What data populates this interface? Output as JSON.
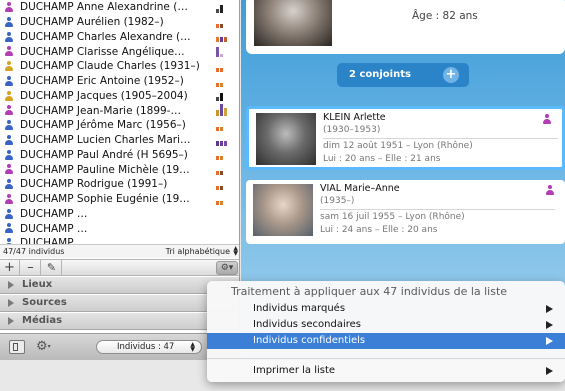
{
  "persons": [
    {
      "name": "DUCHAMP Anne Alexandrine (…",
      "sex": "f",
      "bars": [
        {
          "h": 4,
          "c": "#4a4a4a"
        },
        {
          "h": 8,
          "c": "#222222"
        }
      ]
    },
    {
      "name": "DUCHAMP Aurélien (1982–)",
      "sex": "m",
      "bars": [
        {
          "h": 4,
          "c": "#e86d2c"
        },
        {
          "h": 4,
          "c": "#8a4a2c"
        }
      ]
    },
    {
      "name": "DUCHAMP Charles Alexandre (…",
      "sex": "m",
      "bars": [
        {
          "h": 5,
          "c": "#e07a2a"
        },
        {
          "h": 5,
          "c": "#6b3b9a"
        },
        {
          "h": 5,
          "c": "#c25f2a"
        }
      ]
    },
    {
      "name": "DUCHAMP Clarisse Angélique…",
      "sex": "f",
      "bars": [
        {
          "h": 10,
          "c": "#7a55a6"
        },
        {
          "h": 3,
          "c": "#c9a8dc"
        }
      ]
    },
    {
      "name": "DUCHAMP Claude Charles (1931–)",
      "sex": "u",
      "bars": [
        {
          "h": 4,
          "c": "#e86d2c"
        },
        {
          "h": 4,
          "c": "#e86d2c"
        }
      ]
    },
    {
      "name": "DUCHAMP Eric Antoine (1952–)",
      "sex": "m",
      "bars": [
        {
          "h": 4,
          "c": "#e86d2c"
        },
        {
          "h": 4,
          "c": "#d9832f"
        }
      ]
    },
    {
      "name": "DUCHAMP Jacques (1905–2004)",
      "sex": "u",
      "bars": [
        {
          "h": 4,
          "c": "#444444"
        },
        {
          "h": 8,
          "c": "#111111"
        }
      ]
    },
    {
      "name": "DUCHAMP Jean-Marie (1899-…",
      "sex": "f",
      "bars": [
        {
          "h": 6,
          "c": "#c9962a"
        },
        {
          "h": 12,
          "c": "#6a4aa0"
        },
        {
          "h": 8,
          "c": "#d4a23a"
        }
      ]
    },
    {
      "name": "DUCHAMP Jérôme Marc (1956–)",
      "sex": "m",
      "bars": [
        {
          "h": 4,
          "c": "#e86d2c"
        },
        {
          "h": 4,
          "c": "#d9832f"
        }
      ]
    },
    {
      "name": "DUCHAMP Lucien Charles Mari…",
      "sex": "m",
      "bars": [
        {
          "h": 5,
          "c": "#5a3a8a"
        },
        {
          "h": 5,
          "c": "#6b3b9a"
        },
        {
          "h": 5,
          "c": "#7a4aa8"
        }
      ]
    },
    {
      "name": "DUCHAMP Paul André (H 5695–)",
      "sex": "m",
      "bars": [
        {
          "h": 4,
          "c": "#e86d2c"
        },
        {
          "h": 4,
          "c": "#d9832f"
        }
      ]
    },
    {
      "name": "DUCHAMP Pauline Michèle (19…",
      "sex": "f",
      "bars": [
        {
          "h": 4,
          "c": "#e86d2c"
        },
        {
          "h": 4,
          "c": "#8a4a2c"
        }
      ]
    },
    {
      "name": "DUCHAMP Rodrigue (1991–)",
      "sex": "m",
      "bars": [
        {
          "h": 4,
          "c": "#e86d2c"
        },
        {
          "h": 4,
          "c": "#8a4a2c"
        }
      ]
    },
    {
      "name": "DUCHAMP Sophie Eugénie (19…",
      "sex": "f",
      "bars": [
        {
          "h": 4,
          "c": "#e86d2c"
        },
        {
          "h": 4,
          "c": "#d9832f"
        }
      ]
    },
    {
      "name": "DUCHAMP …",
      "sex": "m",
      "bars": []
    },
    {
      "name": "DUCHAMP …",
      "sex": "m",
      "bars": []
    },
    {
      "name": "DUCHAMP …",
      "sex": "m",
      "bars": []
    }
  ],
  "list_footer": {
    "count": "47/47 individus",
    "sort": "Tri alphabétique"
  },
  "toolbar": {
    "add": "+",
    "remove": "–",
    "edit": "✎",
    "gear": "⚙▾"
  },
  "sections": [
    {
      "label": "Lieux"
    },
    {
      "label": "Sources"
    },
    {
      "label": "Médias"
    }
  ],
  "bottom_bar": {
    "filter_label": "Individus : 47"
  },
  "top_person": {
    "age": "Âge : 82 ans"
  },
  "conjoints": {
    "label": "2 conjoints",
    "add": "+"
  },
  "spouses": [
    {
      "name": "KLEIN Arlette",
      "years": "(1930–1953)",
      "event": "dim 12 août 1951 – Lyon (Rhône)",
      "ages": "Lui : 20 ans – Elle : 21 ans"
    },
    {
      "name": "VIAL Marie–Anne",
      "years": "(1935–)",
      "event": "sam 16 juil 1955 – Lyon (Rhône)",
      "ages": "Lui : 24 ans – Elle : 20 ans"
    }
  ],
  "menu": {
    "header": "Traitement à appliquer aux 47 individus de la liste",
    "items": [
      {
        "label": "Individus marqués"
      },
      {
        "label": "Individus secondaires"
      },
      {
        "label": "Individus confidentiels"
      },
      {
        "label": "Imprimer la liste"
      }
    ]
  },
  "colors": {
    "accent_blue": "#3b7fd7",
    "male": "#3a63c6",
    "female": "#b43cb4",
    "unknown": "#d6a222"
  }
}
